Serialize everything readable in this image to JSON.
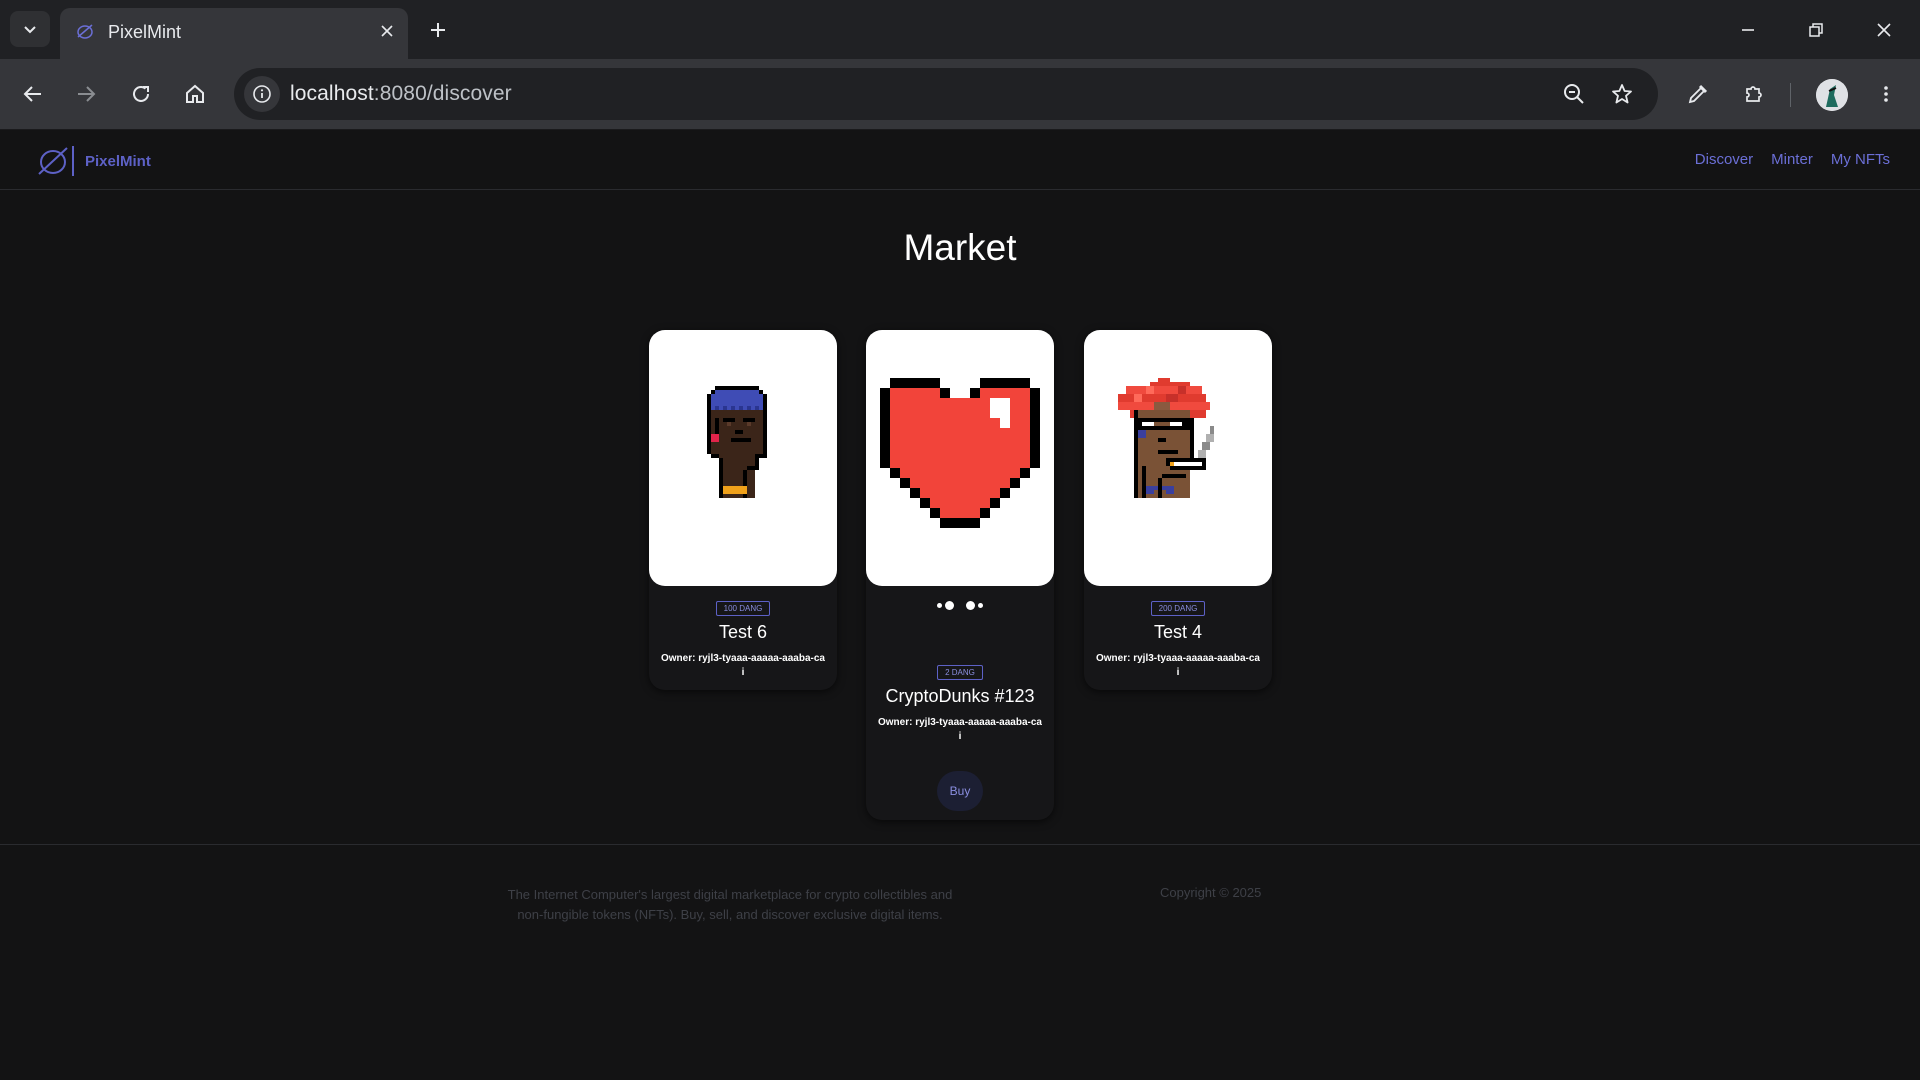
{
  "browser": {
    "tab_title": "PixelMint",
    "url_host": "localhost",
    "url_rest": ":8080/discover"
  },
  "nav": {
    "brand": "PixelMint",
    "links": [
      "Discover",
      "Minter",
      "My NFTs"
    ]
  },
  "page_title": "Market",
  "cards": [
    {
      "name": "Test 6",
      "price": "100 DANG",
      "owner": "Owner: ryjl3-tyaaa-aaaaa-aaaba-cai",
      "image": "pixel-punk-beanie",
      "loading": false,
      "buy_label": ""
    },
    {
      "name": "CryptoDunks #123",
      "price": "2 DANG",
      "owner": "Owner: ryjl3-tyaaa-aaaaa-aaaba-cai",
      "image": "pixel-heart",
      "loading": true,
      "buy_label": "Buy"
    },
    {
      "name": "Test 4",
      "price": "200 DANG",
      "owner": "Owner: ryjl3-tyaaa-aaaaa-aaaba-cai",
      "image": "pixel-punk-red-hair",
      "loading": false,
      "buy_label": ""
    }
  ],
  "footer": {
    "line1": "The Internet Computer's largest digital marketplace for crypto collectibles and",
    "line2": "non-fungible tokens (NFTs). Buy, sell, and discover exclusive digital items.",
    "copyright": "Copyright © 2025"
  },
  "colors": {
    "accent": "#5d61c6",
    "background": "#131314",
    "card_image_bg": "#ffffff"
  }
}
